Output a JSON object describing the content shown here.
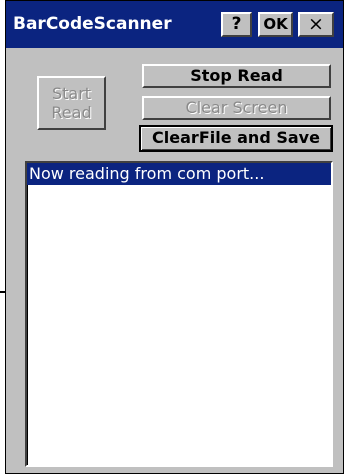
{
  "window": {
    "title": "BarCodeScanner",
    "help_label": "?",
    "ok_label": "OK",
    "close_label": "×"
  },
  "buttons": {
    "start_read_line1": "Start",
    "start_read_line2": "Read",
    "stop_read": "Stop Read",
    "clear_screen": "Clear Screen",
    "clear_file_save": "ClearFile and Save"
  },
  "log": {
    "items": [
      {
        "text": "Now reading from com port...",
        "selected": true
      }
    ]
  },
  "colors": {
    "titlebar": "#0b2480",
    "face": "#c0c0c0",
    "selection": "#0b2480"
  }
}
